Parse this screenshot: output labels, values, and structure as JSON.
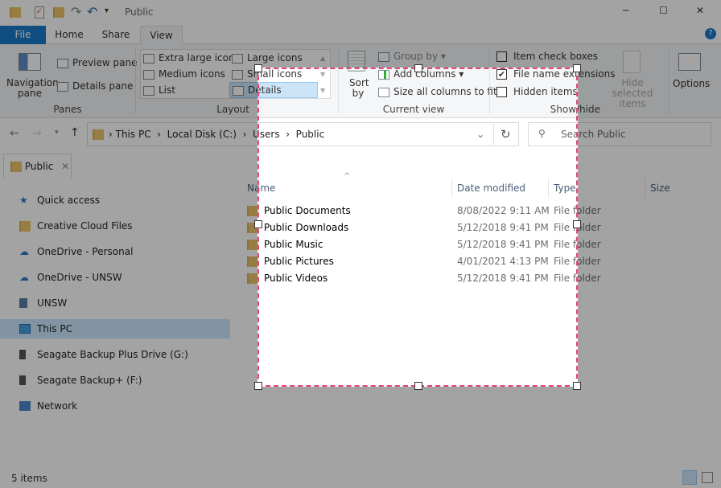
{
  "title": "Public",
  "window_controls": {
    "minimize": "─",
    "maximize": "☐",
    "close": "✕"
  },
  "ribbon_tabs": [
    "File",
    "Home",
    "Share",
    "View"
  ],
  "ribbon": {
    "panes": {
      "label": "Panes",
      "navigation_pane": "Navigation pane",
      "preview_pane": "Preview pane",
      "details_pane": "Details pane"
    },
    "layout": {
      "label": "Layout",
      "items": [
        "Extra large icons",
        "Large icons",
        "Medium icons",
        "Small icons",
        "List",
        "Details"
      ],
      "selected": "Details"
    },
    "current_view": {
      "label": "Current view",
      "sort_by": "Sort by",
      "group_by": "Group by",
      "add_columns": "Add columns",
      "size_all": "Size all columns to fit"
    },
    "show_hide": {
      "label": "Show/hide",
      "item_check_boxes": {
        "label": "Item check boxes",
        "checked": false
      },
      "file_name_extensions": {
        "label": "File name extensions",
        "checked": true
      },
      "hidden_items": {
        "label": "Hidden items",
        "checked": false
      },
      "hide_selected": "Hide selected items"
    },
    "options": "Options"
  },
  "address": {
    "path": [
      "This PC",
      "Local Disk (C:)",
      "Users",
      "Public"
    ],
    "search_placeholder": "Search Public"
  },
  "folder_tab": "Public",
  "sidebar": [
    "Quick access",
    "Creative Cloud Files",
    "OneDrive - Personal",
    "OneDrive - UNSW",
    "UNSW",
    "This PC",
    "Seagate Backup Plus Drive (G:)",
    "Seagate Backup+ (F:)",
    "Network"
  ],
  "sidebar_selected": "This PC",
  "columns": [
    "Name",
    "Date modified",
    "Type",
    "Size"
  ],
  "files": [
    {
      "name": "Public Documents",
      "date": "8/08/2022 9:11 AM",
      "type": "File folder"
    },
    {
      "name": "Public Downloads",
      "date": "5/12/2018 9:41 PM",
      "type": "File folder"
    },
    {
      "name": "Public Music",
      "date": "5/12/2018 9:41 PM",
      "type": "File folder"
    },
    {
      "name": "Public Pictures",
      "date": "4/01/2021 4:13 PM",
      "type": "File folder"
    },
    {
      "name": "Public Videos",
      "date": "5/12/2018 9:41 PM",
      "type": "File folder"
    }
  ],
  "status": "5 items",
  "selection_color": "#e8457a"
}
